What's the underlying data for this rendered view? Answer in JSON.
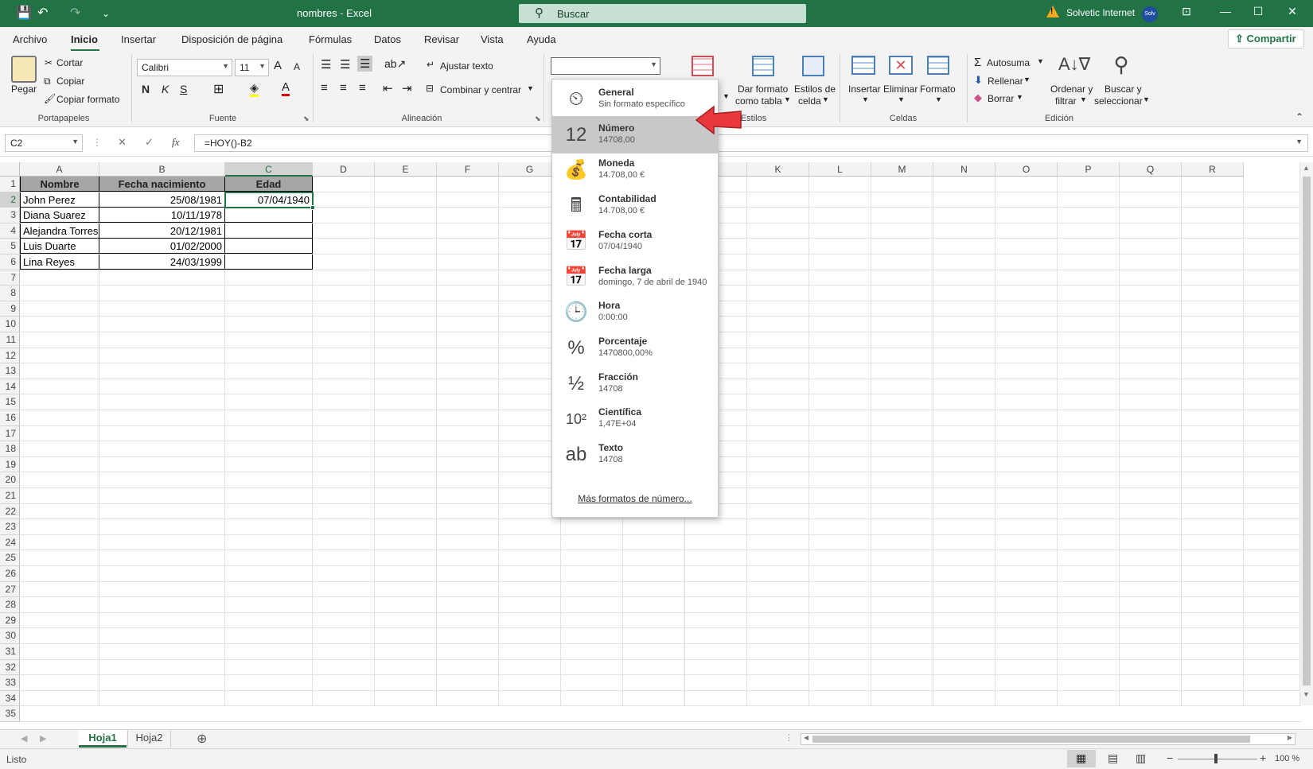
{
  "titlebar": {
    "qat_save": "💾",
    "qat_undo": "↶",
    "qat_redo": "↷",
    "qat_more": "⌄",
    "doc_title": "nombres  -  Excel",
    "search_icon": "⚲",
    "search_placeholder": "Buscar",
    "warning_glyph": "!",
    "user_name": "Solvetic Internet",
    "avatar_text": "Solv",
    "btn_ribbon_display": "⊡",
    "btn_minimize": "—",
    "btn_maximize": "☐",
    "btn_close": "✕"
  },
  "tabs": [
    "Archivo",
    "Inicio",
    "Insertar",
    "Disposición de página",
    "Fórmulas",
    "Datos",
    "Revisar",
    "Vista",
    "Ayuda"
  ],
  "share_label": "Compartir",
  "ribbon": {
    "clipboard": {
      "paste": "Pegar",
      "cut": "Cortar",
      "copy": "Copiar",
      "format_painter": "Copiar formato",
      "label": "Portapapeles"
    },
    "font": {
      "name": "Calibri",
      "size": "11",
      "bold": "N",
      "italic": "K",
      "underline": "S",
      "grow": "A",
      "shrink": "A",
      "label": "Fuente"
    },
    "alignment": {
      "wrap": "Ajustar texto",
      "merge": "Combinar y centrar",
      "label": "Alineación"
    },
    "number": {
      "format_value": ""
    },
    "styles": {
      "cond_fmt": "l",
      "table_fmt_1": "Dar formato",
      "table_fmt_2": "como tabla",
      "cell_styles_1": "Estilos de",
      "cell_styles_2": "celda",
      "label": "Estilos"
    },
    "cells": {
      "insert": "Insertar",
      "delete": "Eliminar",
      "format": "Formato",
      "label": "Celdas"
    },
    "editing": {
      "autosum": "Autosuma",
      "fill": "Rellenar",
      "clear": "Borrar",
      "sort_1": "Ordenar y",
      "sort_2": "filtrar",
      "find_1": "Buscar y",
      "find_2": "seleccionar",
      "label": "Edición"
    }
  },
  "formula_bar": {
    "name_box": "C2",
    "cancel": "✕",
    "enter": "✓",
    "fx": "fx",
    "formula": "=HOY()-B2"
  },
  "columns": [
    "A",
    "B",
    "C",
    "D",
    "E",
    "F",
    "G",
    "H",
    "I",
    "J",
    "K",
    "L",
    "M",
    "N",
    "O",
    "P",
    "Q",
    "R"
  ],
  "rows": [
    "1",
    "2",
    "3",
    "4",
    "5",
    "6",
    "7",
    "8",
    "9",
    "10",
    "11",
    "12",
    "13",
    "14",
    "15",
    "16",
    "17",
    "18",
    "19",
    "20",
    "21",
    "22",
    "23",
    "24",
    "25",
    "26",
    "27",
    "28",
    "29",
    "30",
    "31",
    "32",
    "33",
    "34",
    "35"
  ],
  "table": {
    "headers": [
      "Nombre",
      "Fecha nacimiento",
      "Edad"
    ],
    "data": [
      [
        "John Perez",
        "25/08/1981",
        "07/04/1940"
      ],
      [
        "Diana Suarez",
        "10/11/1978",
        ""
      ],
      [
        "Alejandra Torres",
        "20/12/1981",
        ""
      ],
      [
        "Luis Duarte",
        "01/02/2000",
        ""
      ],
      [
        "Lina Reyes",
        "24/03/1999",
        ""
      ]
    ]
  },
  "number_format_menu": {
    "options": [
      {
        "icon": "⏲",
        "name": "General",
        "value": "Sin formato específico"
      },
      {
        "icon": "12",
        "name": "Número",
        "value": "14708,00"
      },
      {
        "icon": "💰",
        "name": "Moneda",
        "value": "14.708,00 €"
      },
      {
        "icon": "🖩",
        "name": "Contabilidad",
        "value": " 14.708,00 €"
      },
      {
        "icon": "📅",
        "name": "Fecha corta",
        "value": "07/04/1940"
      },
      {
        "icon": "📅",
        "name": "Fecha larga",
        "value": "domingo, 7 de abril de 1940"
      },
      {
        "icon": "🕒",
        "name": "Hora",
        "value": "0:00:00"
      },
      {
        "icon": "%",
        "name": "Porcentaje",
        "value": "1470800,00%"
      },
      {
        "icon": "½",
        "name": "Fracción",
        "value": "14708"
      },
      {
        "icon": "10²",
        "name": "Científica",
        "value": "1,47E+04"
      },
      {
        "icon": "ab",
        "name": "Texto",
        "value": "14708"
      }
    ],
    "more": "Más formatos de número..."
  },
  "sheets": [
    "Hoja1",
    "Hoja2"
  ],
  "add_sheet": "⊕",
  "status": {
    "ready": "Listo",
    "zoom": "100 %"
  },
  "colors": {
    "accent": "#217346",
    "highlight": "#c8c8c8",
    "arrow": "#e8383d"
  }
}
